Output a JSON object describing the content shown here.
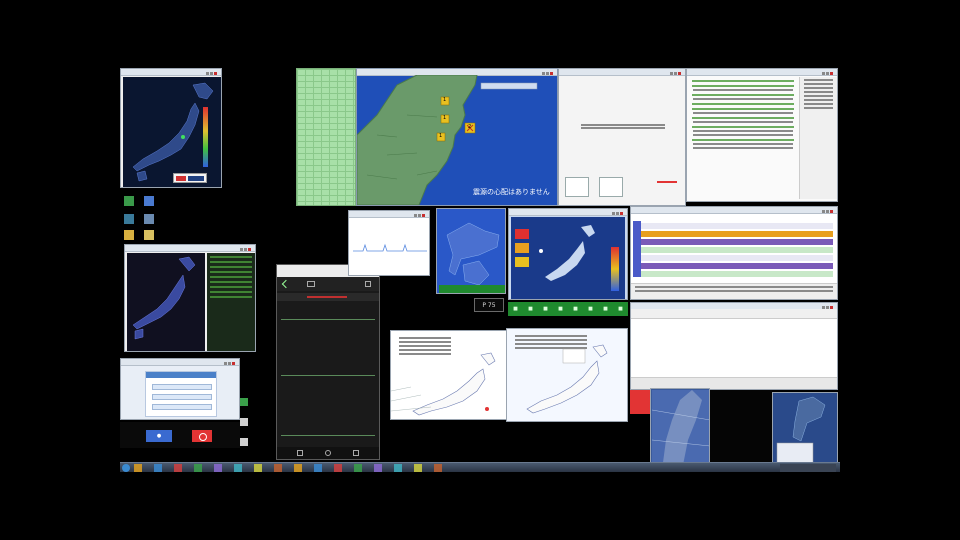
{
  "colors": {
    "sea_blue": "#1f4fb8",
    "land_green": "#6a9a6a",
    "map_dark": "#0a1630",
    "alert_red": "#e23434",
    "status_green": "#1f8a2e",
    "quake_marker": "#e8c020",
    "highlight_orange": "#e8a020",
    "highlight_purple": "#7a5ab8"
  },
  "main_map_window": {
    "caption": "震源の心配はありません",
    "region_label": "",
    "marker_values": [
      "1",
      "1",
      "1",
      "2"
    ]
  },
  "small_map_window": {
    "logo_icon": "network-logo-icon"
  },
  "status_panel": {
    "label": "P 75",
    "bar_items": [
      "■",
      "■",
      "■",
      "■",
      "■",
      "■",
      "■",
      "■"
    ]
  },
  "phone_window": {
    "header_icons": [
      "back-icon",
      "home-icon",
      "menu-icon"
    ],
    "footer_icons": [
      "back-icon",
      "home-icon",
      "recent-icon"
    ]
  },
  "login_window": {
    "button_label": "●",
    "stop_icon": "stop-icon"
  },
  "taskbar": {
    "icons": [
      "folder-icon",
      "browser-icon",
      "media-icon",
      "terminal-icon",
      "settings-icon",
      "map-icon",
      "chart-icon",
      "chat-icon",
      "mail-icon",
      "calc-icon",
      "note-icon",
      "video-icon",
      "music-icon",
      "photo-icon",
      "game-icon",
      "clock-icon"
    ]
  }
}
